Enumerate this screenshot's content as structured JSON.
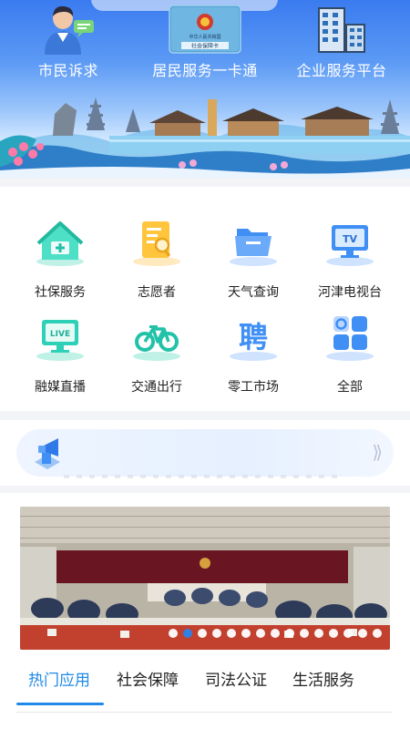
{
  "quick_links": [
    {
      "label": "市民诉求",
      "icon": "citizen-chat-icon"
    },
    {
      "label": "居民服务一卡通",
      "icon": "social-security-card-icon",
      "card_title": "中华人民共和国",
      "card_sub": "社会保障卡"
    },
    {
      "label": "企业服务平台",
      "icon": "office-building-icon"
    }
  ],
  "services": [
    {
      "label": "社保服务",
      "icon": "house-plus-icon"
    },
    {
      "label": "志愿者",
      "icon": "volunteer-document-icon"
    },
    {
      "label": "天气查询",
      "icon": "folder-icon"
    },
    {
      "label": "河津电视台",
      "icon": "tv-icon",
      "badge": "TV"
    },
    {
      "label": "融媒直播",
      "icon": "live-screen-icon",
      "badge": "LIVE"
    },
    {
      "label": "交通出行",
      "icon": "bicycle-icon"
    },
    {
      "label": "零工市场",
      "icon": "hiring-icon",
      "badge": "聘"
    },
    {
      "label": "全部",
      "icon": "all-apps-icon"
    }
  ],
  "notice": {
    "icon": "megaphone-icon",
    "more_icon": "double-chevron-right-icon"
  },
  "carousel": {
    "total_slides": 15,
    "active_slide": 2
  },
  "tabs": [
    {
      "label": "热门应用",
      "active": true
    },
    {
      "label": "社会保障",
      "active": false
    },
    {
      "label": "司法公证",
      "active": false
    },
    {
      "label": "生活服务",
      "active": false
    }
  ],
  "colors": {
    "accent": "#1f8ae8",
    "banner_top": "#3a7bf0",
    "icon_teal": "#2fd0b8",
    "icon_blue": "#3f8ff5",
    "icon_gold": "#ffb421"
  }
}
